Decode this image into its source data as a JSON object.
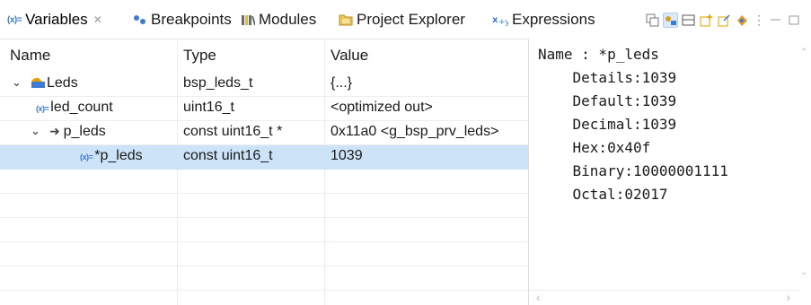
{
  "tabs": [
    {
      "label": "Variables",
      "icon": "variables-icon",
      "active": true,
      "close": "✕"
    },
    {
      "label": "Breakpoints",
      "icon": "breakpoints-icon"
    },
    {
      "label": "Modules",
      "icon": "modules-icon"
    },
    {
      "label": "Project Explorer",
      "icon": "project-explorer-icon"
    },
    {
      "label": "Expressions",
      "icon": "expressions-icon"
    }
  ],
  "table": {
    "headers": {
      "name": "Name",
      "type": "Type",
      "value": "Value"
    },
    "rows": [
      {
        "name": "Leds",
        "type": "bsp_leds_t",
        "value": "{...}",
        "expanded": true,
        "icon": "struct-icon"
      },
      {
        "name": "led_count",
        "type": "uint16_t",
        "value": "<optimized out>",
        "icon": "variable-icon"
      },
      {
        "name": "p_leds",
        "type": "const uint16_t *",
        "value": "0x11a0 <g_bsp_prv_leds>",
        "expanded": true,
        "icon": "pointer-icon"
      },
      {
        "name": "*p_leds",
        "type": "const uint16_t",
        "value": "1039",
        "selected": true,
        "icon": "variable-icon"
      }
    ]
  },
  "details": {
    "lines": [
      "Name : *p_leds",
      "    Details:1039",
      "    Default:1039",
      "    Decimal:1039",
      "    Hex:0x40f",
      "    Binary:10000001111",
      "    Octal:02017"
    ]
  },
  "colors": {
    "selection": "#cde3f8",
    "accent": "#3d7bd6"
  }
}
